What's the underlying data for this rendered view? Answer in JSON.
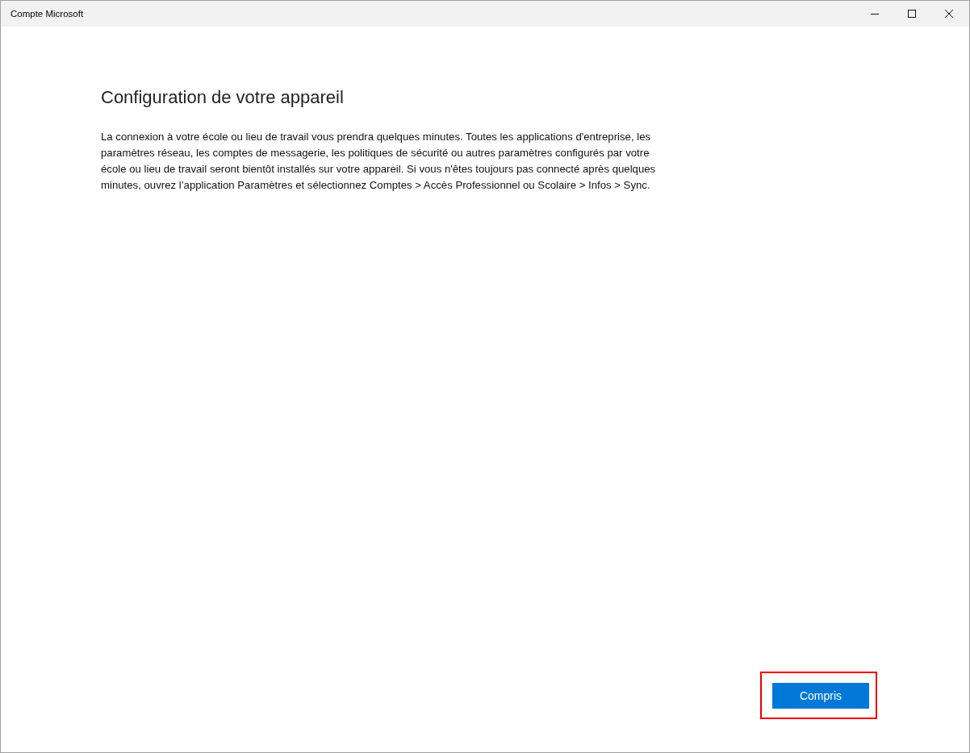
{
  "window": {
    "title": "Compte Microsoft"
  },
  "heading": "Configuration de votre appareil",
  "description": "La connexion à votre école ou lieu de travail vous prendra quelques minutes. Toutes les applications d'entreprise, les paramètres réseau, les comptes de messagerie, les politiques de sécurité ou autres paramètres configurés par votre école ou lieu de travail seront bientôt installés sur votre appareil. Si vous n'êtes toujours pas connecté après quelques minutes, ouvrez l’application Paramètres et sélectionnez Comptes > Accès Professionnel ou Scolaire > Infos > Sync.",
  "button": {
    "label": "Compris",
    "highlighted": true
  }
}
